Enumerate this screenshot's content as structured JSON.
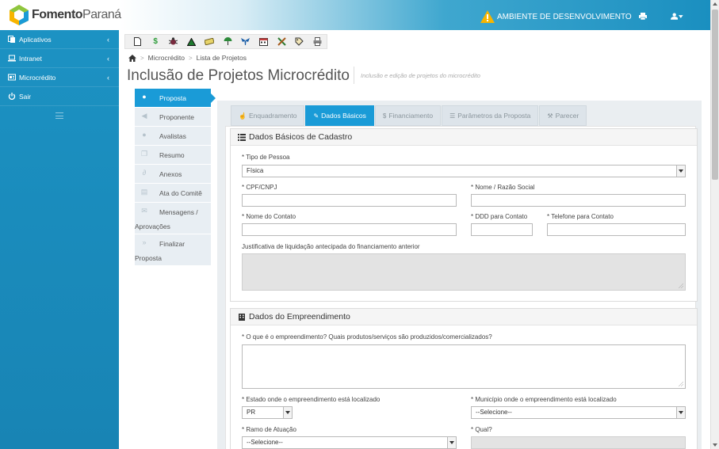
{
  "brand": {
    "name_part1": "Fomento",
    "name_part2": "Paraná",
    "colors": {
      "hex_green": "#8dc63f",
      "hex_blue": "#1a9bd7",
      "hex_yellow": "#f7b500"
    }
  },
  "header": {
    "environment_label": "AMBIENTE DE DESENVOLVIMENTO",
    "warning_icon": "warning-icon",
    "print_icon": "print-icon",
    "user_icon": "user-icon"
  },
  "sidebar": {
    "items": [
      {
        "label": "Aplicativos",
        "icon": "copy-icon",
        "has_chevron": true
      },
      {
        "label": "Intranet",
        "icon": "laptop-icon",
        "has_chevron": true
      },
      {
        "label": "Microcrédito",
        "icon": "id-card-icon",
        "has_chevron": true
      },
      {
        "label": "Sair",
        "icon": "power-icon",
        "has_chevron": false
      }
    ],
    "collapse_icon": "menu-icon"
  },
  "toolbar": {
    "icons": [
      "document-icon",
      "dollar-icon",
      "bug-icon",
      "triangle-icon",
      "money-icon",
      "umbrella-icon",
      "tie-icon",
      "calendar-icon",
      "tools-icon",
      "tag-icon",
      "printer-icon"
    ]
  },
  "breadcrumb": {
    "home_icon": "home-icon",
    "items": [
      "Microcrédito",
      "Lista de Projetos"
    ]
  },
  "page": {
    "title": "Inclusão de Projetos Microcrédito",
    "subtitle": "Inclusão e edição de projetos do microcrédito"
  },
  "steps": [
    {
      "label": "Proposta",
      "active": true,
      "icon": "user-icon"
    },
    {
      "label": "Proponente",
      "active": false,
      "icon": "volume-icon"
    },
    {
      "label": "Avalistas",
      "active": false,
      "icon": "user-icon"
    },
    {
      "label": "Resumo",
      "active": false,
      "icon": "copy-icon"
    },
    {
      "label": "Anexos",
      "active": false,
      "icon": "paperclip-icon"
    },
    {
      "label": "Ata do Comitê",
      "active": false,
      "icon": "file-icon"
    },
    {
      "label": "Mensagens /",
      "label2": "Aprovações",
      "active": false,
      "icon": "envelope-icon"
    },
    {
      "label": "Finalizar",
      "label2": "Proposta",
      "active": false,
      "icon": "forward-icon"
    }
  ],
  "tabs": [
    {
      "label": "Enquadramento",
      "icon": "thumbs-up-icon",
      "active": false
    },
    {
      "label": "Dados Básicos",
      "icon": "pencil-icon",
      "active": true
    },
    {
      "label": "Financiamento",
      "icon": "dollar-icon",
      "active": false
    },
    {
      "label": "Parâmetros da Proposta",
      "icon": "list-icon",
      "active": false
    },
    {
      "label": "Parecer",
      "icon": "gavel-icon",
      "active": false
    }
  ],
  "section1": {
    "title": "Dados Básicos de Cadastro",
    "tipo_pessoa": {
      "label": "* Tipo de Pessoa",
      "value": "Física"
    },
    "cpf": {
      "label": "* CPF/CNPJ",
      "value": ""
    },
    "nome": {
      "label": "* Nome / Razão Social",
      "value": ""
    },
    "contato": {
      "label": "* Nome do Contato",
      "value": ""
    },
    "ddd": {
      "label": "* DDD para Contato",
      "value": ""
    },
    "telefone": {
      "label": "* Telefone para Contato",
      "value": ""
    },
    "justificativa": {
      "label": "Justificativa de liquidação antecipada do financiamento anterior",
      "value": ""
    }
  },
  "section2": {
    "title": "Dados do Empreendimento",
    "oque": {
      "label": "* O que é o empreendimento? Quais produtos/serviços são produzidos/comercializados?",
      "value": ""
    },
    "estado": {
      "label": "* Estado onde o empreendimento está localizado",
      "value": "PR"
    },
    "municipio": {
      "label": "* Município onde o empreendimento está localizado",
      "value": "--Selecione--"
    },
    "ramo": {
      "label": "* Ramo de Atuação",
      "value": "--Selecione--"
    },
    "qual": {
      "label": "* Qual?",
      "value": ""
    }
  }
}
